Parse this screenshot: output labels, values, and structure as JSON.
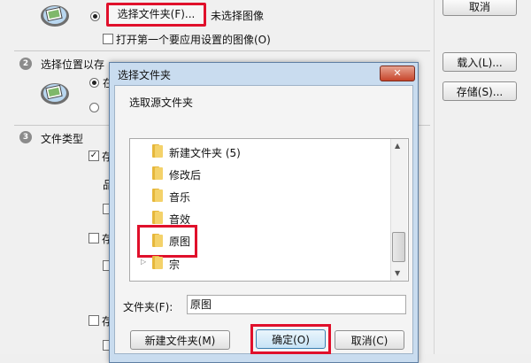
{
  "main": {
    "top_button_label": "选择文件夹(F)...",
    "no_image_status": "未选择图像",
    "open_first_checkbox_label": "打开第一个要应用设置的图像(O)",
    "section2_title": "选择位置以存",
    "section2_radio1_fragment": "在",
    "section3_title": "文件类型",
    "section3_check_fragment": "存",
    "quality_fragment": "品",
    "check2_fragment": "存",
    "check3_fragment": "存",
    "step2_number": "2",
    "step3_number": "3"
  },
  "side_buttons": {
    "cancel": "取消",
    "load": "载入(L)...",
    "save": "存储(S)..."
  },
  "dialog": {
    "title": "选择文件夹",
    "close_glyph": "✕",
    "prompt": "选取源文件夹",
    "folders": [
      {
        "label": "新建文件夹 (5)"
      },
      {
        "label": "修改后"
      },
      {
        "label": "音乐"
      },
      {
        "label": "音效"
      },
      {
        "label": "原图"
      },
      {
        "label": "宗"
      }
    ],
    "folder_field_label": "文件夹(F):",
    "folder_field_value": "原图",
    "new_folder_button": "新建文件夹(M)",
    "ok_button": "确定(O)",
    "cancel_button": "取消(C)"
  },
  "colors": {
    "highlight_red": "#e0102b"
  }
}
